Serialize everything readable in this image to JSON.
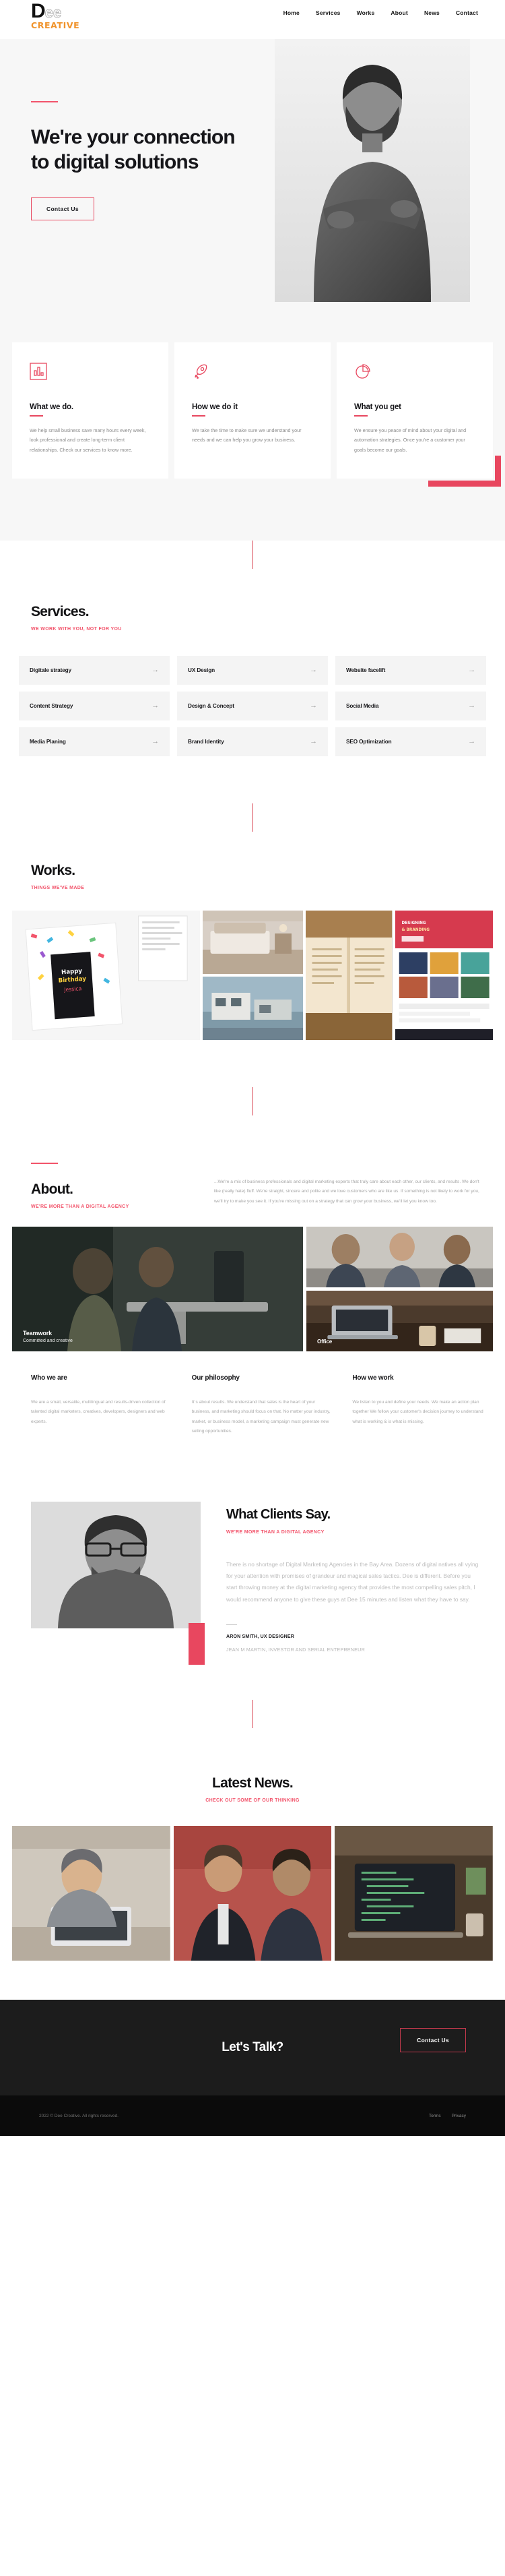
{
  "brand": {
    "logo_main_bold": "D",
    "logo_main_outline": "ee",
    "logo_sub": "CREATIVE"
  },
  "nav": {
    "items": [
      {
        "label": "Home"
      },
      {
        "label": "Services"
      },
      {
        "label": "Works"
      },
      {
        "label": "About"
      },
      {
        "label": "News"
      },
      {
        "label": "Contact"
      }
    ]
  },
  "hero": {
    "title": "We're your connection to digital solutions",
    "cta_label": "Contact Us"
  },
  "features": [
    {
      "icon": "bar-chart-icon",
      "title": "What we do.",
      "body": "We help small business save many hours every week, look professional and create long-term client relationships. Check our services to know more."
    },
    {
      "icon": "rocket-icon",
      "title": "How we do it",
      "body": "We take the time to make sure we understand your needs and we can help you grow your business."
    },
    {
      "icon": "pie-chart-icon",
      "title": "What you get",
      "body": "We ensure you peace of mind about your digital and automation strategies. Once you're a customer your goals become our goals."
    }
  ],
  "services": {
    "title": "Services.",
    "subtitle": "WE WORK WITH YOU, NOT FOR YOU",
    "items": [
      {
        "label": "Digitale strategy"
      },
      {
        "label": "UX Design"
      },
      {
        "label": "Website facelift"
      },
      {
        "label": "Content Strategy"
      },
      {
        "label": "Design & Concept"
      },
      {
        "label": "Social Media"
      },
      {
        "label": "Media Planing"
      },
      {
        "label": "Brand Identity"
      },
      {
        "label": "SEO Optimization"
      }
    ],
    "arrow": "→"
  },
  "works": {
    "title": "Works.",
    "subtitle": "THINGS WE'VE MADE"
  },
  "about": {
    "title": "About.",
    "subtitle": "WE'RE MORE THAN A DIGITAL AGENCY",
    "intro": "...We're a mix of business professionals and digital marketing experts that truly care about each other, our clients, and results. We don't like (really hate) fluff. We're straight, sincere and polite and we love customers who are like us. If something is not likely to work for you, we'll try to make you see it. If you're missing out on a strategy that can grow your business, we'll let you know too.",
    "image_labels": {
      "teamwork_title": "Teamwork",
      "teamwork_sub": "Committed and creative",
      "office_title": "Office"
    },
    "columns": [
      {
        "heading": "Who we are",
        "body": "We are a small, versatile, multilingual and results-driven collection of talented digital marketers, creatives, developers, designers and web experts."
      },
      {
        "heading": "Our philosophy",
        "body": "It´s about results. We understand that sales is the heart of your business, and marketing should focus on that. No matter your industry, market, or business model, a marketing campaign must generate new selling opportunities."
      },
      {
        "heading": "How we work",
        "body": "We listen to you and define your needs. We make an action plan together We follow your customer's decision journey to understand what is working & is what is missing."
      }
    ]
  },
  "testimonial": {
    "title": "What Clients Say.",
    "subtitle": "WE'RE MORE THAN A DIGITAL AGENCY",
    "quote": "There is no shortage of Digital Marketing Agencies in the Bay Area. Dozens of digital natives all vying for your attention with promises of grandeur and magical sales tactics. Dee is different. Before you start throwing money at the digital marketing agency that provides the most compelling sales pitch, I would recommend anyone to give these guys at Dee 15 minutes and listen what they have to say.",
    "author": "ARON SMITH, UX DESIGNER",
    "author_role": "JEAN M MARTIN, INVESTOR AND SERIAL ENTEPRENEUR"
  },
  "news": {
    "title": "Latest News.",
    "subtitle": "CHECK OUT SOME OF OUR THINKING"
  },
  "footer": {
    "cta_title": "Let's Talk?",
    "cta_button": "Contact Us",
    "copyright": "2022 © Dee Creative. All rights reserved.",
    "links": [
      {
        "label": "Terms"
      },
      {
        "label": "Privacy"
      }
    ]
  },
  "colors": {
    "accent_red": "#e8475f",
    "accent_pink": "#f2546b",
    "logo_orange": "#f0932b",
    "dark": "#1c1c1c"
  }
}
